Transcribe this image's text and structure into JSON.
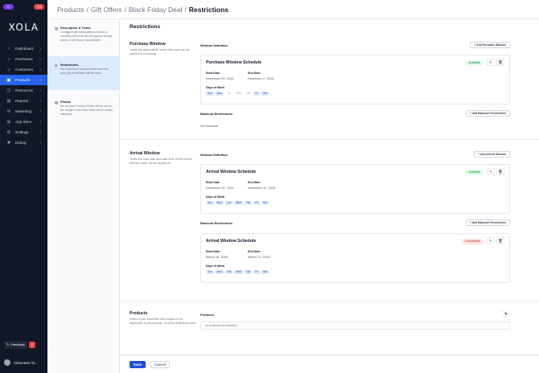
{
  "sidebar": {
    "badge_left": "0",
    "badge_right": "-24",
    "logo": "XOLA",
    "items": [
      {
        "label": "Dashboard",
        "icon": "dashboard-icon"
      },
      {
        "label": "Purchases",
        "icon": "purchases-icon"
      },
      {
        "label": "Customers",
        "icon": "customers-icon"
      },
      {
        "label": "Products",
        "icon": "products-icon",
        "active": true
      },
      {
        "label": "Resources",
        "icon": "resources-icon"
      },
      {
        "label": "Reports",
        "icon": "reports-icon"
      },
      {
        "label": "Marketing",
        "icon": "marketing-icon"
      },
      {
        "label": "App Store",
        "icon": "app-store-icon"
      },
      {
        "label": "Settings",
        "icon": "settings-icon"
      },
      {
        "label": "Debug",
        "icon": "debug-icon"
      }
    ],
    "feedback_label": "Feedback",
    "feedback_count": "0",
    "account_name": "Adventure To..."
  },
  "header": {
    "crumbs": [
      "Products",
      "Gift Offers",
      "Black Friday Deal"
    ],
    "current": "Restrictions"
  },
  "steps": [
    {
      "title": "Description & Terms",
      "desc": "Configure gift certificates at a fixed or variable price that can be applied across some or all of your experiences."
    },
    {
      "title": "Restrictions",
      "desc": "Set restrictions around when and how your gift certificates will be used."
    },
    {
      "title": "Photos",
      "desc": "Set as your Primary Photo will be set as the image in the back office and in online checkout."
    }
  ],
  "main": {
    "title": "Restrictions",
    "purchase": {
      "title": "Purchase Window",
      "desc": "Limits the dates within which this code can be applied to a booking",
      "window_def_label": "Window Definition",
      "add_window_label": "+ Add Purchase Window",
      "card": {
        "title": "Purchase Window Schedule",
        "status": "Available",
        "start_label": "Start Date",
        "start_value": "November 29, 2024",
        "end_label": "End Date",
        "end_value": "December 2, 2024",
        "days_label": "Days of Week",
        "days": [
          {
            "d": "Sun",
            "on": true
          },
          {
            "d": "Mon",
            "on": true
          },
          {
            "d": "Tue",
            "on": false
          },
          {
            "d": "Wed",
            "on": false
          },
          {
            "d": "Thu",
            "on": false
          },
          {
            "d": "Fri",
            "on": true
          },
          {
            "d": "Sat",
            "on": true
          }
        ]
      },
      "blackout_label": "Blackout Restrictions",
      "add_blackout_label": "+ Add Blackout Restrictions",
      "no_blackouts": "No blackouts"
    },
    "arrival": {
      "title": "Arrival Window",
      "desc": "Limits the start date and start time of the events that this code can be applied to",
      "window_def_label": "Window Definition",
      "add_window_label": "+ Add Arrival Window",
      "card": {
        "title": "Arrival Window Schedule",
        "status": "Available",
        "start_label": "Start Date",
        "start_value": "November 29, 2024",
        "end_label": "End Date",
        "end_value": "December 31, 2025",
        "days_label": "Days of Week",
        "days": [
          {
            "d": "Sun",
            "on": true
          },
          {
            "d": "Mon",
            "on": true
          },
          {
            "d": "Tue",
            "on": true
          },
          {
            "d": "Wed",
            "on": true
          },
          {
            "d": "Thu",
            "on": true
          },
          {
            "d": "Fri",
            "on": true
          },
          {
            "d": "Sat",
            "on": true
          }
        ]
      },
      "blackout_label": "Blackout Restrictions",
      "add_blackout_label": "+ Add Blackout Restrictions",
      "blackout_card": {
        "title": "Arrival Window Schedule",
        "status": "Unavailable",
        "start_label": "Start Date",
        "start_value": "March 16, 2025",
        "end_label": "End Date",
        "end_value": "March 22, 2025",
        "days_label": "Days of Week",
        "days": [
          {
            "d": "Sun",
            "on": true
          },
          {
            "d": "Mon",
            "on": true
          },
          {
            "d": "Tue",
            "on": true
          },
          {
            "d": "Wed",
            "on": true
          },
          {
            "d": "Thu",
            "on": true
          },
          {
            "d": "Fri",
            "on": true
          },
          {
            "d": "Sat",
            "on": true
          }
        ]
      }
    },
    "products": {
      "title": "Products",
      "desc": "Select if you would like this coupon to be applicable to all products, or select individual ones",
      "label": "Products",
      "value": "All products are selected"
    },
    "save_label": "Save",
    "cancel_label": "Cancel"
  },
  "colors": {
    "accent": "#2563eb",
    "sidebar": "#111827",
    "available": "#15803d",
    "unavailable": "#dc2626"
  }
}
